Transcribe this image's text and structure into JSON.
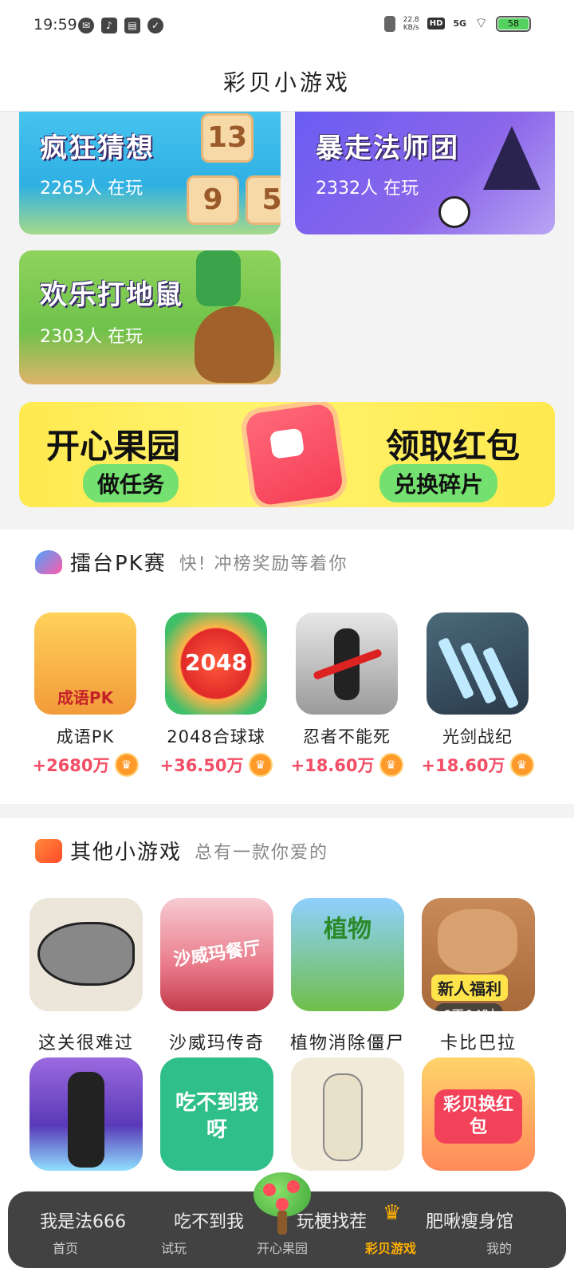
{
  "status_bar": {
    "time": "19:59",
    "net_speed_value": "22.8",
    "net_speed_unit": "KB/s",
    "hd": "HD",
    "network": "5G",
    "battery": "58"
  },
  "header": {
    "title": "彩贝小游戏"
  },
  "featured_games": [
    {
      "name": "疯狂猜想",
      "players": "2265人 在玩"
    },
    {
      "name": "暴走法师团",
      "players": "2332人 在玩"
    },
    {
      "name": "欢乐打地鼠",
      "players": "2303人 在玩"
    }
  ],
  "tiles": [
    "13",
    "9",
    "5"
  ],
  "banner": {
    "left_title": "开心果园",
    "left_tag": "做任务",
    "right_title": "领取红包",
    "right_tag": "兑换碎片"
  },
  "pk_section": {
    "title": "擂台PK赛",
    "subtitle": "快! 冲榜奖励等着你",
    "items": [
      {
        "name": "成语PK",
        "reward": "+2680万",
        "thumb_text": "成语PK"
      },
      {
        "name": "2048合球球",
        "reward": "+36.50万",
        "thumb_text": "2048"
      },
      {
        "name": "忍者不能死",
        "reward": "+18.60万",
        "thumb_text": ""
      },
      {
        "name": "光剑战纪",
        "reward": "+18.60万",
        "thumb_text": ""
      }
    ]
  },
  "other_section": {
    "title": "其他小游戏",
    "subtitle": "总有一款你爱的",
    "row1": [
      {
        "name": "这关很难过",
        "thumb_text": ""
      },
      {
        "name": "沙威玛传奇",
        "thumb_text": "沙威玛餐厅"
      },
      {
        "name": "植物消除僵尸",
        "thumb_text": "植物"
      },
      {
        "name": "卡比巴拉",
        "thumb_text": "",
        "tag_new": "新人福利",
        "tag_time": "6天04时"
      }
    ],
    "row2": [
      {
        "thumb_text": ""
      },
      {
        "thumb_text": "吃不到我呀"
      },
      {
        "thumb_text": ""
      },
      {
        "thumb_text": "彩贝换红包"
      }
    ]
  },
  "bottom_nav": {
    "items": [
      {
        "label": "首页",
        "peek": "我是法666"
      },
      {
        "label": "试玩",
        "peek": "吃不到我"
      },
      {
        "label": "开心果园",
        "peek": "玩梗找茬"
      },
      {
        "label": "彩贝游戏",
        "peek": ""
      },
      {
        "label": "我的",
        "peek": "肥啾瘦身馆"
      }
    ],
    "active_color": "#ffb000"
  },
  "colors": {
    "reward_text": "#f24e66",
    "banner_yellow": "#ffe94f",
    "banner_green": "#73e06f"
  }
}
